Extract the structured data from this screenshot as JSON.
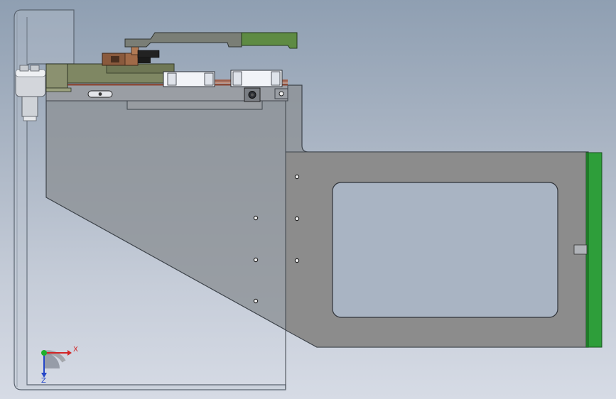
{
  "viewport": {
    "background_top": "#8f9fb2",
    "background_bottom": "#d6dbe5"
  },
  "colors": {
    "housing_edge": "#55606d",
    "plate_fill": "#8e9297",
    "tray_fill": "#8c8c8c",
    "clamp_green": "#5e8b43",
    "green_bar": "#2e9e3a",
    "bracket_olive": "#7f8763",
    "copper_rail": "#a0604c",
    "block_brown": "#8a5a3d",
    "block_white": "#f2f4f8",
    "axis_x": "#d22525",
    "axis_y": "#1fb02b",
    "axis_z": "#2446c8"
  },
  "triad": {
    "x_axis_label": "X",
    "z_axis_label": "Z",
    "x_icon": "x-axis-arrow-icon",
    "y_icon": "y-axis-dot-icon",
    "z_icon": "z-axis-arrow-icon"
  }
}
